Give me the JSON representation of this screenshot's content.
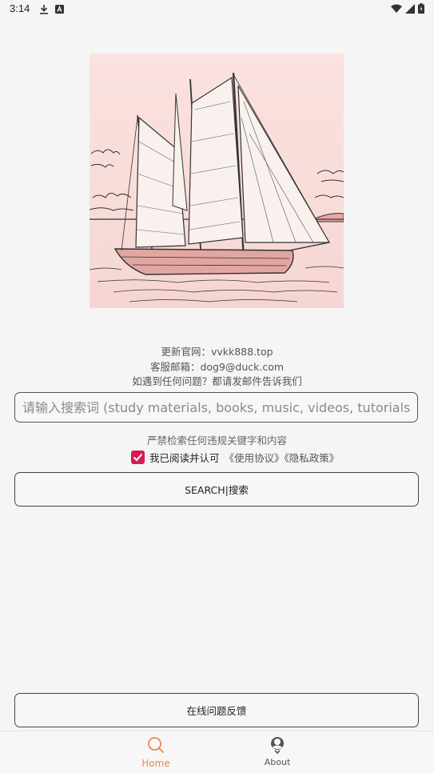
{
  "status_bar": {
    "time": "3:14"
  },
  "info": {
    "line1": "更新官网：vvkk888.top",
    "line2": "客服邮箱：dog9@duck.com",
    "line3": "如遇到任何问题？都请发邮件告诉我们"
  },
  "search": {
    "placeholder": "请输入搜索词 (study materials, books, music, videos, tutorials...)",
    "value": ""
  },
  "warning": "严禁检索任何违规关键字和内容",
  "agreement": {
    "checked": true,
    "text": "我已阅读并认可",
    "links": "《使用协议》《隐私政策》"
  },
  "buttons": {
    "search_label": "SEARCH|搜索",
    "feedback_label": "在线问题反馈"
  },
  "nav": {
    "home_label": "Home",
    "about_label": "About",
    "active": "home",
    "active_color": "#e98a4e"
  },
  "colors": {
    "checkbox": "#d81b54",
    "background": "#f5f5f5"
  }
}
